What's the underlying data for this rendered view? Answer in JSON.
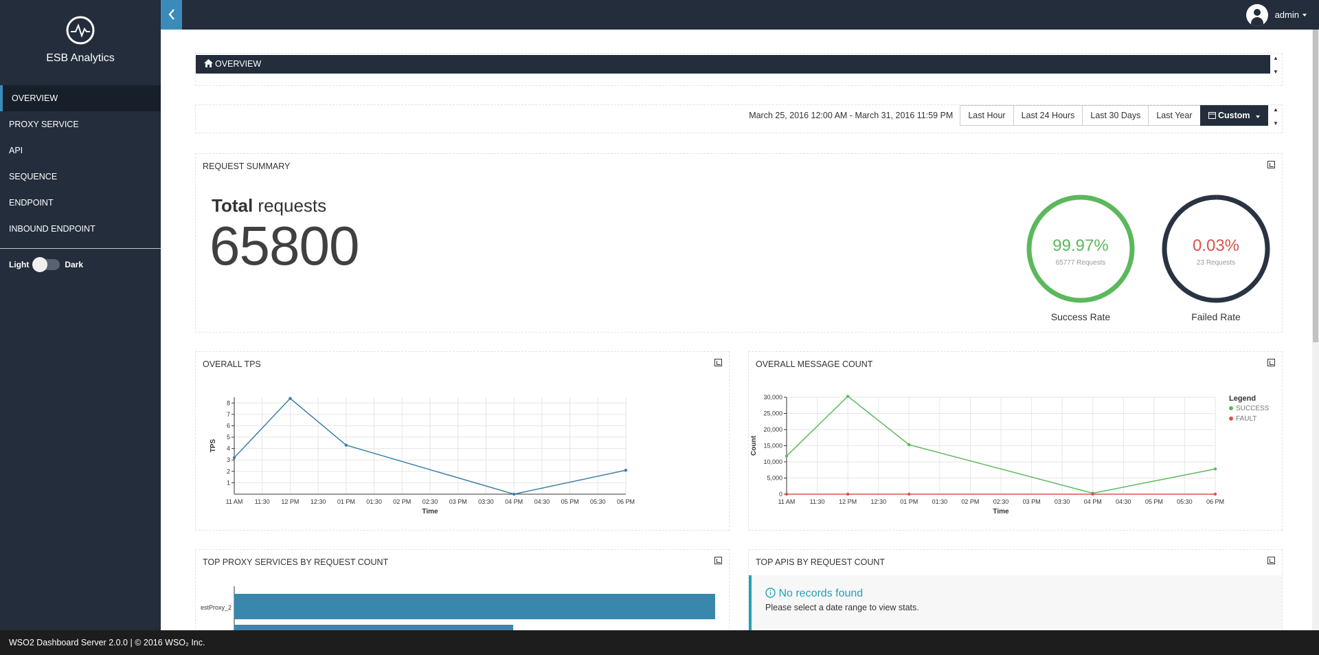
{
  "app": {
    "title": "ESB Analytics"
  },
  "sidebar": {
    "items": [
      {
        "label": "OVERVIEW",
        "active": true
      },
      {
        "label": "PROXY SERVICE"
      },
      {
        "label": "API"
      },
      {
        "label": "SEQUENCE"
      },
      {
        "label": "ENDPOINT"
      },
      {
        "label": "INBOUND ENDPOINT"
      }
    ],
    "theme_light": "Light",
    "theme_dark": "Dark"
  },
  "topbar": {
    "user": "admin"
  },
  "overview": {
    "title": "OVERVIEW"
  },
  "date_picker": {
    "range_text": "March 25, 2016 12:00 AM - March 31, 2016 11:59 PM",
    "buttons": [
      "Last Hour",
      "Last 24 Hours",
      "Last 30 Days",
      "Last Year"
    ],
    "custom": "Custom"
  },
  "request_summary": {
    "title": "REQUEST SUMMARY",
    "total_bold": "Total",
    "total_rest": " requests",
    "total_value": "65800",
    "success": {
      "pct": "99.97%",
      "sub": "65777 Requests",
      "label": "Success Rate",
      "color": "#5cb85c"
    },
    "failed": {
      "pct": "0.03%",
      "sub": "23 Requests",
      "label": "Failed Rate",
      "color": "#d9534f",
      "ring": "#2a3342"
    }
  },
  "tps": {
    "title": "OVERALL TPS"
  },
  "message_count": {
    "title": "OVERALL MESSAGE COUNT",
    "legend_title": "Legend"
  },
  "top_proxy": {
    "title": "TOP PROXY SERVICES BY REQUEST COUNT",
    "bar_label": "estProxy_2"
  },
  "top_apis": {
    "title": "TOP APIS BY REQUEST COUNT",
    "no_records": "No records found",
    "hint": "Please select a date range to view stats."
  },
  "footer": {
    "text": "WSO2 Dashboard Server 2.0.0 | © 2016 WSO₂ Inc."
  },
  "chart_data": [
    {
      "type": "line",
      "title": "OVERALL TPS",
      "xlabel": "Time",
      "ylabel": "TPS",
      "x": [
        "11 AM",
        "11:30",
        "12 PM",
        "12:30",
        "01 PM",
        "01:30",
        "02 PM",
        "02:30",
        "03 PM",
        "03:30",
        "04 PM",
        "04:30",
        "05 PM",
        "05:30",
        "06 PM"
      ],
      "yticks": [
        1,
        2,
        3,
        4,
        5,
        6,
        7,
        8
      ],
      "ylim": [
        0,
        8.5
      ],
      "series": [
        {
          "color": "#3a7fa7",
          "points": [
            [
              0,
              3.2
            ],
            [
              2,
              8.4
            ],
            [
              4,
              4.3
            ],
            [
              10,
              0
            ],
            [
              14,
              2.1
            ]
          ]
        }
      ],
      "grid": true
    },
    {
      "type": "line",
      "title": "OVERALL MESSAGE COUNT",
      "xlabel": "Time",
      "ylabel": "Count",
      "x": [
        "11 AM",
        "11:30",
        "12 PM",
        "12:30",
        "01 PM",
        "01:30",
        "02 PM",
        "02:30",
        "03 PM",
        "03:30",
        "04 PM",
        "04:30",
        "05 PM",
        "05:30",
        "06 PM"
      ],
      "yticks": [
        "0",
        "5,000",
        "10,000",
        "15,000",
        "20,000",
        "25,000",
        "30,000"
      ],
      "ylim": [
        0,
        30000
      ],
      "series": [
        {
          "name": "SUCCESS",
          "color": "#5cb85c",
          "points": [
            [
              0,
              11800
            ],
            [
              2,
              30300
            ],
            [
              4,
              15300
            ],
            [
              10,
              300
            ],
            [
              14,
              7800
            ]
          ]
        },
        {
          "name": "FAULT",
          "color": "#d9534f",
          "points": [
            [
              0,
              0
            ],
            [
              2,
              0
            ],
            [
              4,
              0
            ],
            [
              10,
              0
            ],
            [
              14,
              0
            ]
          ]
        }
      ],
      "legend": "top-right",
      "grid": true
    },
    {
      "type": "bar",
      "title": "TOP PROXY SERVICES BY REQUEST COUNT",
      "categories": [
        "estProxy_2"
      ],
      "values": [
        100,
        58
      ],
      "color": "#3a87ad"
    }
  ]
}
